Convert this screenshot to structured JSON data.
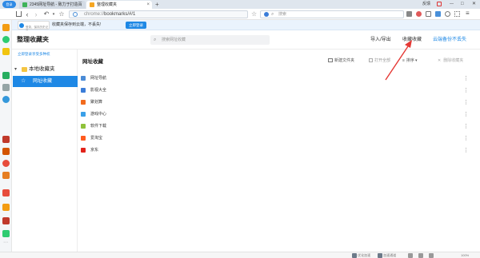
{
  "window": {
    "avatar_label": "登录",
    "tabs": [
      {
        "label": "2345网址导航 - 致力于打造百",
        "active": false
      },
      {
        "label": "整理收藏夹",
        "active": true
      }
    ],
    "new_tab_label": "+",
    "controls": {
      "feedback_label": "反馈",
      "minimize": "—",
      "maximize": "□",
      "close": "✕"
    }
  },
  "navbar": {
    "address_value": "chrome://bookmarks/#/1",
    "address_prefix": "chrome://",
    "address_path": "bookmarks/#/1",
    "search_placeholder": "搜索"
  },
  "banner": {
    "text": "收藏夹保存到云端，不丢失!",
    "login_button": "立即登录",
    "tooltip_line1": "登录，保存历史记录"
  },
  "page": {
    "title": "整理收藏夹",
    "search_placeholder": "搜索网址收藏",
    "import_export": "导入/导出",
    "organize": "收藏收藏",
    "cloud_backup": "云端备份不丢失"
  },
  "left_panel": {
    "login_hint": "立即登录享受多种权",
    "local_folder": "本地收藏夹",
    "selected_folder": "网址收藏"
  },
  "main": {
    "folder_title": "网址收藏",
    "new_folder": "新建文件夹",
    "open_all": "打开全部",
    "sort": "排序",
    "delete_all": "删除收藏夹",
    "bookmarks": [
      {
        "label": "网址导航",
        "color": "#4a8bd6"
      },
      {
        "label": "影视大全",
        "color": "#3b7dd8"
      },
      {
        "label": "聚划算",
        "color": "#f26b1d"
      },
      {
        "label": "游戏中心",
        "color": "#3aa0e8"
      },
      {
        "label": "软件下载",
        "color": "#8fc23a"
      },
      {
        "label": "爱淘宝",
        "color": "#ff5b1f"
      },
      {
        "label": "京东",
        "color": "#e2231a"
      }
    ]
  },
  "statusbar": {
    "left_label": "",
    "opt1": "优化加速",
    "opt2": "加速通道",
    "zoom": "100%"
  },
  "colors": {
    "accent": "#1e88e5",
    "selected_folder_bg": "#1e88e5",
    "annotation_arrow": "#e53935"
  }
}
